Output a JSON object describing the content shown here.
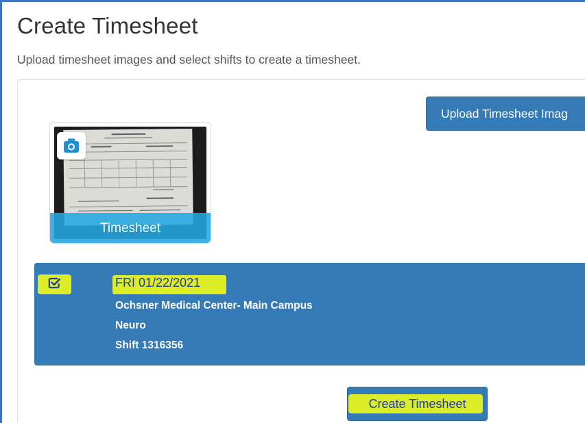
{
  "page": {
    "title": "Create Timesheet",
    "subtitle": "Upload timesheet images and select shifts to create a timesheet."
  },
  "upload": {
    "button_label": "Upload Timesheet Imag"
  },
  "thumbnail": {
    "label": "Timesheet",
    "icon": "camera-icon"
  },
  "shift": {
    "checked": true,
    "date": "FRI 01/22/2021",
    "facility": "Ochsner Medical Center- Main Campus",
    "unit": "Neuro",
    "shift_number": "Shift 1316356"
  },
  "actions": {
    "create_label": "Create Timesheet"
  },
  "colors": {
    "primary": "#337ab7",
    "highlight": "#e6f21e",
    "thumb_label_bg": "#25a6e0",
    "frame_border": "#4472c4"
  }
}
